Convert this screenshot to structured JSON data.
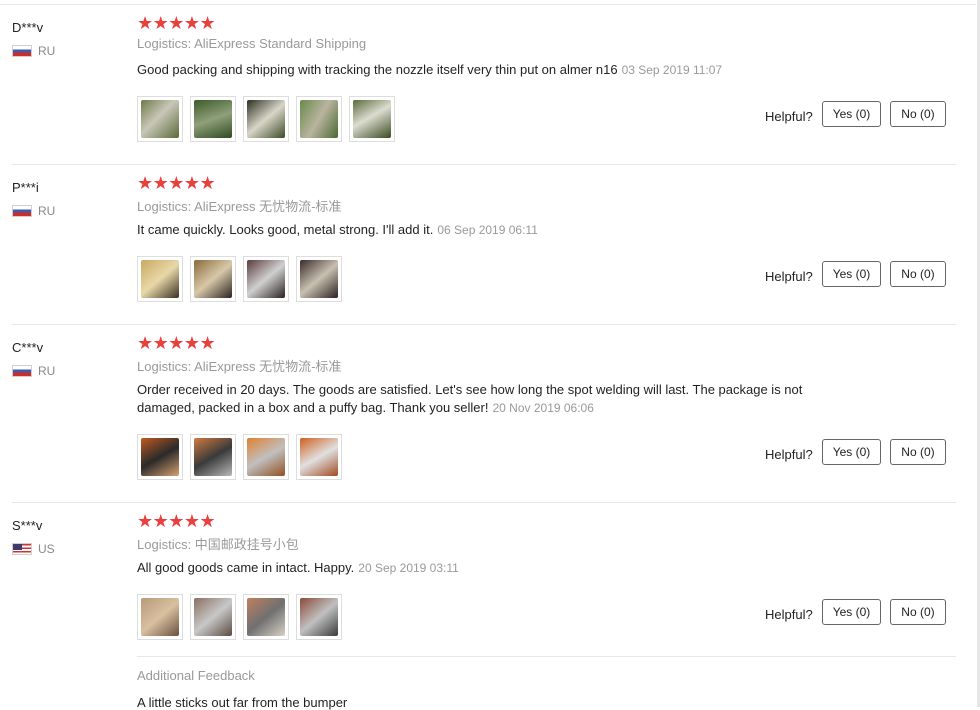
{
  "reviews": [
    {
      "user": "D***v",
      "country": "RU",
      "stars": "★★★★★",
      "logistics": "Logistics: AliExpress Standard Shipping",
      "text": "Good packing and shipping with tracking the nozzle itself very thin put on almer n16",
      "date": "03 Sep 2019 11:07",
      "helpful_label": "Helpful?",
      "yes": "Yes (0)",
      "no": "No (0)"
    },
    {
      "user": "P***i",
      "country": "RU",
      "stars": "★★★★★",
      "logistics": "Logistics: AliExpress 无忧物流-标准",
      "text": "It came quickly. Looks good, metal strong. I'll add it.",
      "date": "06 Sep 2019 06:11",
      "helpful_label": "Helpful?",
      "yes": "Yes (0)",
      "no": "No (0)"
    },
    {
      "user": "C***v",
      "country": "RU",
      "stars": "★★★★★",
      "logistics": "Logistics: AliExpress 无忧物流-标准",
      "text": "Order received in 20 days. The goods are satisfied. Let's see how long the spot welding will last. The package is not damaged, packed in a box and a puffy bag. Thank you seller!",
      "date": "20 Nov 2019 06:06",
      "helpful_label": "Helpful?",
      "yes": "Yes (0)",
      "no": "No (0)"
    },
    {
      "user": "S***v",
      "country": "US",
      "stars": "★★★★★",
      "logistics": "Logistics: 中国邮政挂号小包",
      "text": "All good goods came in intact. Happy.",
      "date": "20 Sep 2019 03:11",
      "helpful_label": "Helpful?",
      "yes": "Yes (0)",
      "no": "No (0)",
      "additional_title": "Additional Feedback",
      "additional_text": "A little sticks out far from the bumper"
    }
  ],
  "colors": {
    "star": "#e8403d",
    "muted": "#999999",
    "border": "#e8e8e8"
  }
}
